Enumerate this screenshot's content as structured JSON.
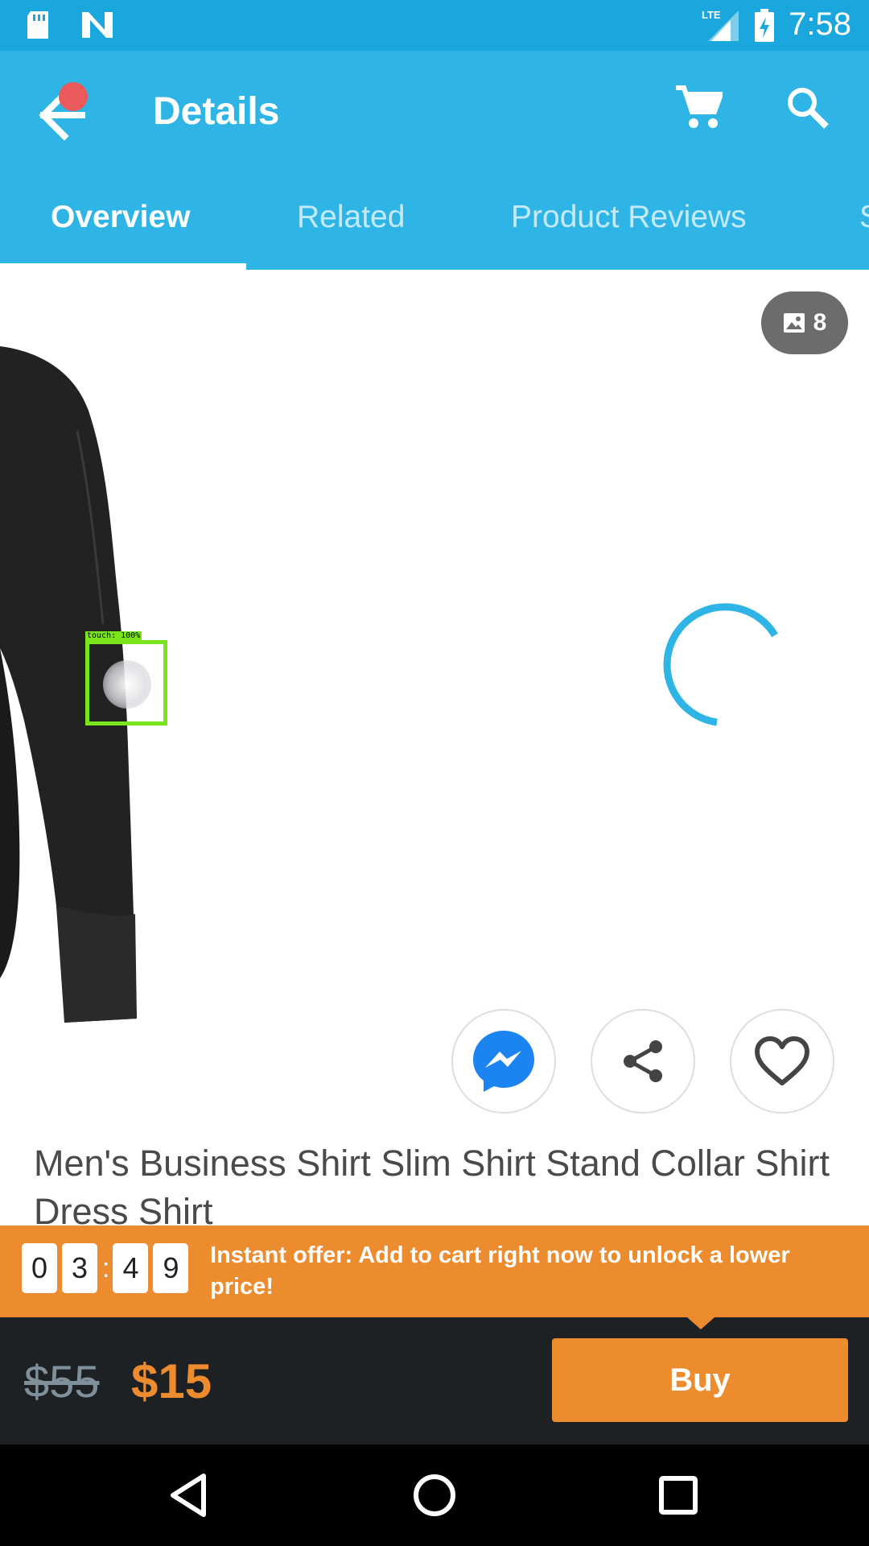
{
  "status_bar": {
    "time": "7:58",
    "left_icons": [
      "sd-card-icon",
      "n-notification-icon"
    ],
    "right_icons": [
      "lte-signal-icon",
      "battery-charging-icon"
    ],
    "network": "LTE",
    "bg_color": "#1aa7dd"
  },
  "app_bar": {
    "title": "Details",
    "bg_color": "#2eb5e6",
    "icons": [
      "back-arrow-icon",
      "cart-icon",
      "search-icon"
    ]
  },
  "tabs": [
    {
      "label": "Overview",
      "active": true
    },
    {
      "label": "Related",
      "active": false
    },
    {
      "label": "Product Reviews",
      "active": false
    },
    {
      "label": "S",
      "active": false
    }
  ],
  "gallery": {
    "photo_count": "8",
    "touch_label": "touch: 100%"
  },
  "actions": [
    "messenger-icon",
    "share-icon",
    "heart-icon"
  ],
  "product": {
    "title": "Men's Business Shirt Slim Shirt Stand Collar Shirt Dress Shirt"
  },
  "offer": {
    "countdown": [
      "0",
      "3",
      "4",
      "9"
    ],
    "separator": ":",
    "text": "Instant offer: Add to cart right now to unlock a lower price!",
    "color": "#ec8c2e"
  },
  "pricing": {
    "old_price": "$55",
    "new_price": "$15",
    "buy_label": "Buy"
  },
  "nav_bar": {
    "icons": [
      "back-triangle-icon",
      "home-circle-icon",
      "recents-square-icon"
    ]
  }
}
